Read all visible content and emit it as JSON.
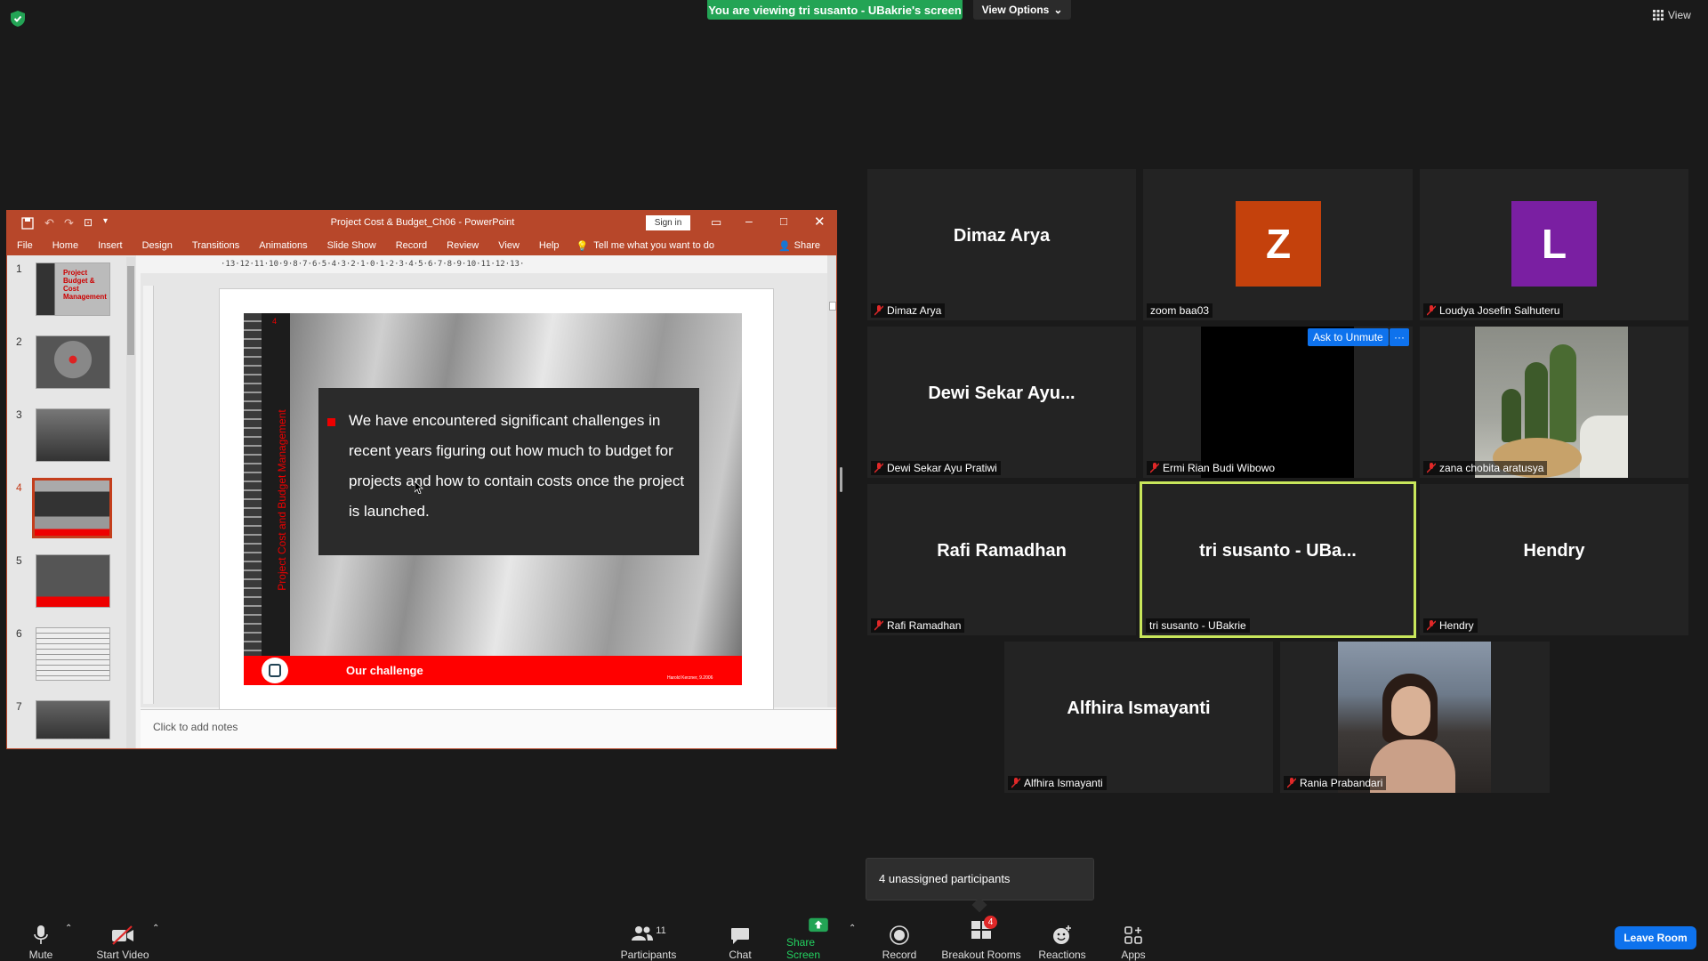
{
  "top_bar": {
    "viewing_banner": "You are viewing tri susanto - UBakrie's screen",
    "view_options": "View Options",
    "view": "View"
  },
  "powerpoint": {
    "title": "Project Cost & Budget_Ch06 - PowerPoint",
    "sign_in": "Sign in",
    "tabs": [
      "File",
      "Home",
      "Insert",
      "Design",
      "Transitions",
      "Animations",
      "Slide Show",
      "Record",
      "Review",
      "View",
      "Help"
    ],
    "tell_me": "Tell me what you want to do",
    "share": "Share",
    "ruler": "·13·12·11·10·9·8·7·6·5·4·3·2·1·0·1·2·3·4·5·6·7·8·9·10·11·12·13·",
    "thumbnail_numbers": [
      "1",
      "2",
      "3",
      "4",
      "5",
      "6",
      "7"
    ],
    "thumb1_title": "Project Budget & Cost Management",
    "notes_placeholder": "Click to add notes",
    "slide": {
      "number": "4",
      "vertical_title": "Project Cost and Budget Management",
      "body": "We have encountered significant challenges in recent years figuring out how much to budget for projects and how to contain costs once the project is launched.",
      "footer_title": "Our challenge",
      "footer_credit": "Harold Kerzner, 9.2006"
    }
  },
  "participants": [
    {
      "display": "Dimaz Arya",
      "label": "Dimaz Arya",
      "muted": true
    },
    {
      "display": "Z",
      "label": "zoom baa03",
      "muted": false,
      "avatar_color": "#c4410c"
    },
    {
      "display": "L",
      "label": "Loudya Josefin Salhuteru",
      "muted": true,
      "avatar_color": "#7a1fa2"
    },
    {
      "display": "Dewi Sekar Ayu...",
      "label": "Dewi Sekar Ayu Pratiwi",
      "muted": true
    },
    {
      "display": "",
      "label": "Ermi Rian Budi Wibowo",
      "muted": true
    },
    {
      "display": "",
      "label": "zana chobita aratusya",
      "muted": true
    },
    {
      "display": "Rafi Ramadhan",
      "label": "Rafi Ramadhan",
      "muted": true
    },
    {
      "display": "tri susanto - UBa...",
      "label": "tri susanto - UBakrie",
      "muted": false
    },
    {
      "display": "Hendry",
      "label": "Hendry",
      "muted": true
    },
    {
      "display": "Alfhira Ismayanti",
      "label": "Alfhira Ismayanti",
      "muted": true
    },
    {
      "display": "",
      "label": "Rania Prabandari",
      "muted": true
    }
  ],
  "ask_to_unmute": "Ask to Unmute",
  "more_dots": "···",
  "unassigned": "4 unassigned participants",
  "toolbar": {
    "mute": "Mute",
    "start_video": "Start Video",
    "participants": "Participants",
    "participants_count": "11",
    "chat": "Chat",
    "share_screen": "Share Screen",
    "record": "Record",
    "breakout_rooms": "Breakout Rooms",
    "breakout_badge": "4",
    "reactions": "Reactions",
    "apps": "Apps",
    "leave_room": "Leave Room"
  },
  "colors": {
    "accent_green": "#23a455",
    "ppt_red": "#b7472a",
    "active_speaker": "#c8e65b",
    "zoom_blue": "#0e72ed"
  }
}
